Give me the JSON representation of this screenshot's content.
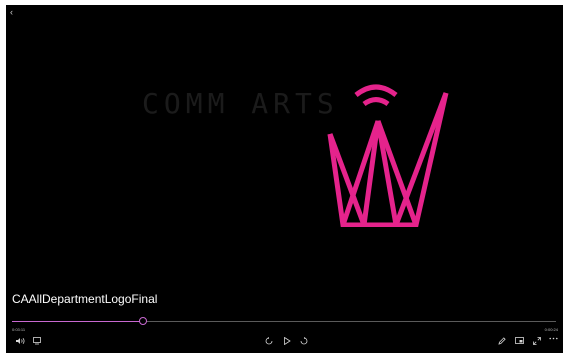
{
  "player": {
    "title": "CAAllDepartmentLogoFinal",
    "watermark_text": "COMM ARTS",
    "time_elapsed": "0:03:11",
    "time_total": "0:00:24",
    "progress_fraction": 0.24
  },
  "colors": {
    "background": "#000000",
    "accent": "#c868d0",
    "logo": "#e5238c",
    "watermark": "#1b1b1b"
  },
  "controls": {
    "left": [
      "volume-icon",
      "subtitles-icon"
    ],
    "center": [
      "skip-back-icon",
      "play-icon",
      "skip-forward-icon"
    ],
    "right": [
      "edit-icon",
      "mini-view-icon",
      "fullscreen-icon",
      "more-icon"
    ]
  }
}
